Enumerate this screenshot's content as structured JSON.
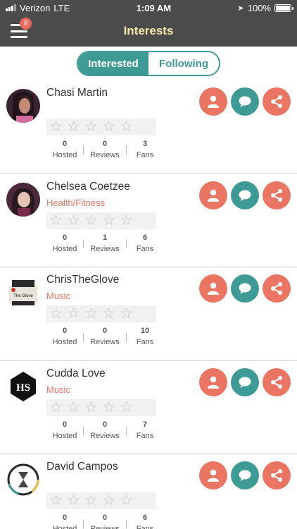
{
  "status_bar": {
    "carrier": "Verizon",
    "network": "LTE",
    "time": "1:09 AM",
    "battery": "100%"
  },
  "header": {
    "title": "Interests",
    "badge": "8"
  },
  "tabs": [
    {
      "label": "Interested",
      "active": true
    },
    {
      "label": "Following",
      "active": false
    }
  ],
  "stat_labels": {
    "hosted": "Hosted",
    "reviews": "Reviews",
    "fans": "Fans"
  },
  "colors": {
    "accent_coral": "#e97562",
    "accent_teal": "#3e9a95",
    "header_bg": "#4b4b4b",
    "title": "#f2e6a8"
  },
  "icons": {
    "follow": "person-icon",
    "message": "chat-bubble-icon",
    "share": "share-icon",
    "star": "star-outline-icon"
  },
  "users": [
    {
      "name": "Chasi Martin",
      "category": "",
      "rating_stars": 0,
      "hosted": "0",
      "reviews": "0",
      "fans": "3"
    },
    {
      "name": "Chelsea Coetzee",
      "category": "Health/Fitness",
      "rating_stars": 0,
      "hosted": "0",
      "reviews": "1",
      "fans": "6"
    },
    {
      "name": "ChrisTheGlove",
      "category": "Music",
      "rating_stars": 0,
      "hosted": "0",
      "reviews": "0",
      "fans": "10",
      "avatar_text": "The Glove"
    },
    {
      "name": "Cudda Love",
      "category": "Music",
      "rating_stars": 0,
      "hosted": "0",
      "reviews": "0",
      "fans": "7"
    },
    {
      "name": "David Campos",
      "category": "",
      "rating_stars": 0,
      "hosted": "0",
      "reviews": "0",
      "fans": "6"
    }
  ]
}
